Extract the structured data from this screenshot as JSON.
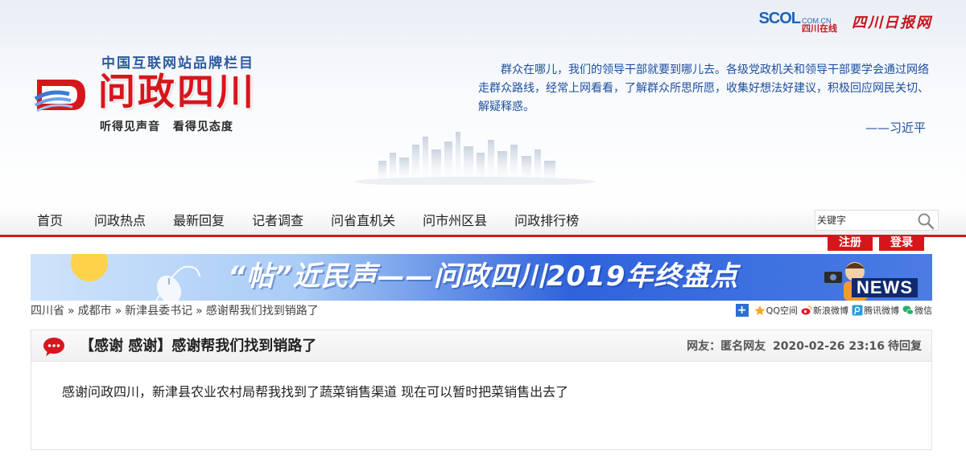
{
  "header": {
    "partner_scol_main": "SCOL",
    "partner_scol_domain": "COM.CN",
    "partner_scol_cn": "四川在线",
    "partner_daily": "四川日报网",
    "brand_tagline_top": "中国互联网站品牌栏目",
    "brand_title": "问政四川",
    "brand_slogan": "听得见声音  看得见态度",
    "quote": "群众在哪儿，我们的领导干部就要到哪儿去。各级党政机关和领导干部要学会通过网络走群众路线，经常上网看看，了解群众所思所愿，收集好想法好建议，积极回应网民关切、解疑释惑。",
    "quote_author": "——习近平"
  },
  "nav": {
    "items": [
      {
        "label": "首页"
      },
      {
        "label": "问政热点"
      },
      {
        "label": "最新回复"
      },
      {
        "label": "记者调查"
      },
      {
        "label": "问省直机关"
      },
      {
        "label": "问市州区县"
      },
      {
        "label": "问政排行榜"
      }
    ],
    "search_placeholder": "关键字",
    "register_label": "注册",
    "login_label": "登录"
  },
  "banner": {
    "title": "“帖”近民声——问政四川2019年终盘点",
    "news_badge": "NEWS"
  },
  "breadcrumb": {
    "items": [
      "四川省",
      "成都市",
      "新津县委书记",
      "感谢帮我们找到销路了"
    ],
    "separator": "»"
  },
  "share": {
    "plus": "+",
    "items": [
      {
        "label": "QQ空间",
        "icon": "qzone-icon",
        "color": "#f5a623"
      },
      {
        "label": "新浪微博",
        "icon": "weibo-icon",
        "color": "#e6162d"
      },
      {
        "label": "腾讯微博",
        "icon": "tencent-weibo-icon",
        "color": "#2a9bd6"
      },
      {
        "label": "微信",
        "icon": "wechat-icon",
        "color": "#2aae67"
      }
    ]
  },
  "post": {
    "title": "【感谢 感谢】感谢帮我们找到销路了",
    "author_label": "网友：匿名网友",
    "datetime": "2020-02-26 23:16",
    "status": "待回复",
    "content": "感谢问政四川，新津县农业农村局帮我找到了蔬菜销售渠道 现在可以暂时把菜销售出去了"
  },
  "colors": {
    "brand_red": "#d7161c",
    "brand_blue": "#1d4fa0"
  }
}
